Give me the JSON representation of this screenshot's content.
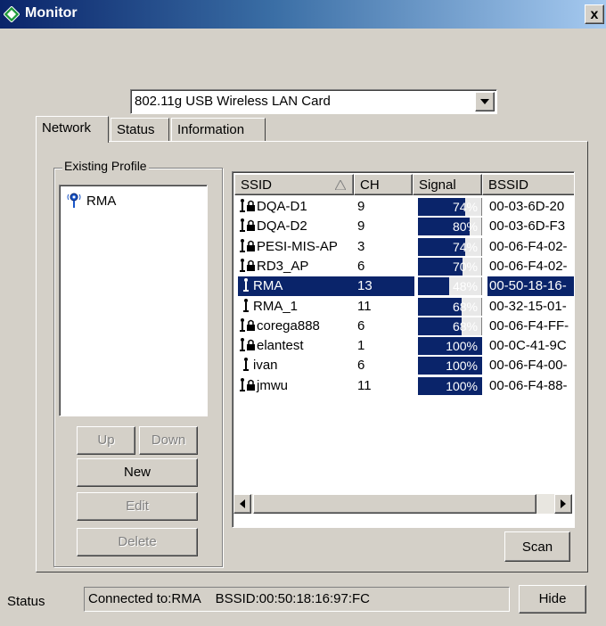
{
  "window": {
    "title": "Monitor",
    "close_label": "x"
  },
  "adapter": {
    "selected": "802.11g USB Wireless LAN Card"
  },
  "tabs": [
    {
      "label": "Network"
    },
    {
      "label": "Status"
    },
    {
      "label": "Information"
    }
  ],
  "profiles": {
    "group_label": "Existing Profile",
    "items": [
      {
        "name": "RMA",
        "icon": "network-profile-icon"
      }
    ],
    "buttons": {
      "up": "Up",
      "down": "Down",
      "new": "New",
      "edit": "Edit",
      "delete": "Delete"
    }
  },
  "networks": {
    "columns": [
      "SSID",
      "CH",
      "Signal",
      "BSSID"
    ],
    "rows": [
      {
        "ssid": "DQA-D1",
        "ch": "9",
        "signal": "74%",
        "signal_value": 74,
        "bssid": "00-03-6D-20",
        "secured": true,
        "selected": false
      },
      {
        "ssid": "DQA-D2",
        "ch": "9",
        "signal": "80%",
        "signal_value": 80,
        "bssid": "00-03-6D-F3",
        "secured": true,
        "selected": false
      },
      {
        "ssid": "PESI-MIS-AP",
        "ch": "3",
        "signal": "74%",
        "signal_value": 74,
        "bssid": "00-06-F4-02-",
        "secured": true,
        "selected": false
      },
      {
        "ssid": "RD3_AP",
        "ch": "6",
        "signal": "70%",
        "signal_value": 70,
        "bssid": "00-06-F4-02-",
        "secured": true,
        "selected": false
      },
      {
        "ssid": "RMA",
        "ch": "13",
        "signal": "48%",
        "signal_value": 48,
        "bssid": "00-50-18-16-",
        "secured": false,
        "selected": true
      },
      {
        "ssid": "RMA_1",
        "ch": "11",
        "signal": "68%",
        "signal_value": 68,
        "bssid": "00-32-15-01-",
        "secured": false,
        "selected": false
      },
      {
        "ssid": "corega888",
        "ch": "6",
        "signal": "68%",
        "signal_value": 68,
        "bssid": "00-06-F4-FF-",
        "secured": true,
        "selected": false
      },
      {
        "ssid": "elantest",
        "ch": "1",
        "signal": "100%",
        "signal_value": 100,
        "bssid": "00-0C-41-9C",
        "secured": true,
        "selected": false
      },
      {
        "ssid": "ivan",
        "ch": "6",
        "signal": "100%",
        "signal_value": 100,
        "bssid": "00-06-F4-00-",
        "secured": false,
        "selected": false
      },
      {
        "ssid": "jmwu",
        "ch": "11",
        "signal": "100%",
        "signal_value": 100,
        "bssid": "00-06-F4-88-",
        "secured": true,
        "selected": false
      }
    ],
    "scan_label": "Scan"
  },
  "status": {
    "label": "Status",
    "value": "Connected to:RMA    BSSID:00:50:18:16:97:FC",
    "hide_label": "Hide"
  },
  "colors": {
    "selection": "#0a246a",
    "face": "#d4d0c8"
  }
}
